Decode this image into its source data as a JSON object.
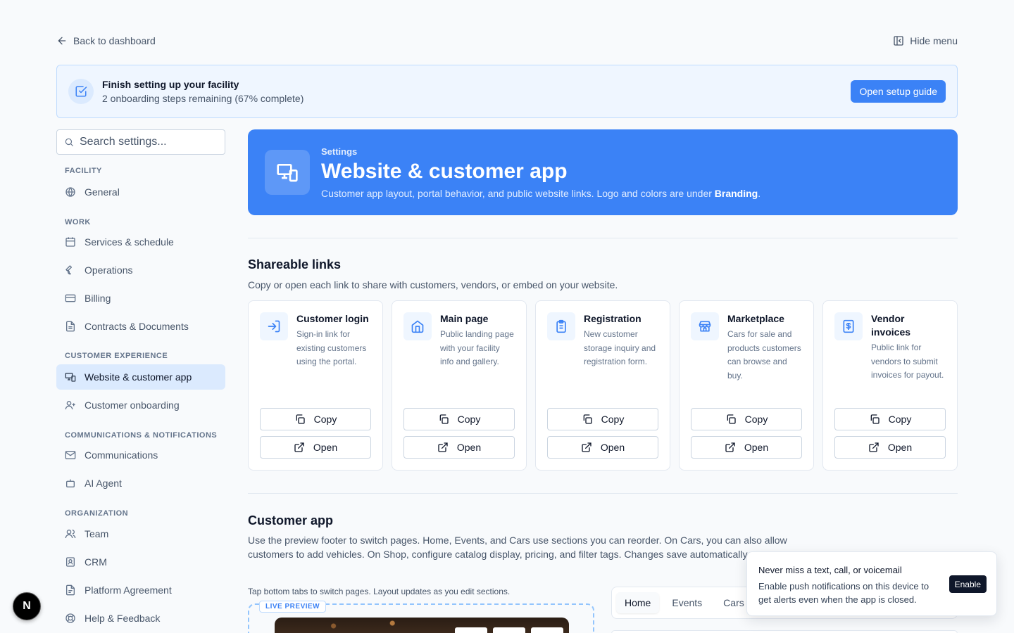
{
  "topbar": {
    "back_label": "Back to dashboard",
    "hide_menu_label": "Hide menu"
  },
  "setup": {
    "title": "Finish setting up your facility",
    "subtitle": "2 onboarding steps remaining (67% complete)",
    "button_label": "Open setup guide"
  },
  "sidebar": {
    "search_placeholder": "Search settings...",
    "groups": [
      {
        "heading": "FACILITY",
        "items": [
          {
            "label": "General",
            "icon": "globe-icon"
          }
        ]
      },
      {
        "heading": "WORK",
        "items": [
          {
            "label": "Services & schedule",
            "icon": "calendar-icon"
          },
          {
            "label": "Operations",
            "icon": "wrench-icon"
          },
          {
            "label": "Billing",
            "icon": "credit-card-icon"
          },
          {
            "label": "Contracts & Documents",
            "icon": "document-icon"
          }
        ]
      },
      {
        "heading": "CUSTOMER EXPERIENCE",
        "items": [
          {
            "label": "Website & customer app",
            "icon": "devices-icon",
            "active": true
          },
          {
            "label": "Customer onboarding",
            "icon": "user-plus-icon"
          }
        ]
      },
      {
        "heading": "COMMUNICATIONS & NOTIFICATIONS",
        "items": [
          {
            "label": "Communications",
            "icon": "mail-icon"
          },
          {
            "label": "AI Agent",
            "icon": "bot-icon"
          }
        ]
      },
      {
        "heading": "ORGANIZATION",
        "items": [
          {
            "label": "Team",
            "icon": "users-icon"
          },
          {
            "label": "CRM",
            "icon": "contact-icon"
          },
          {
            "label": "Platform Agreement",
            "icon": "file-text-icon"
          },
          {
            "label": "Help & Feedback",
            "icon": "help-icon"
          }
        ]
      }
    ]
  },
  "hero": {
    "eyebrow": "Settings",
    "title": "Website & customer app",
    "desc_prefix": "Customer app layout, portal behavior, and public website links. Logo and colors are under ",
    "desc_bold": "Branding",
    "desc_suffix": "."
  },
  "shareable": {
    "title": "Shareable links",
    "desc": "Copy or open each link to share with customers, vendors, or embed on your website.",
    "copy_label": "Copy",
    "open_label": "Open",
    "cards": [
      {
        "title": "Customer login",
        "desc": "Sign-in link for existing customers using the portal.",
        "icon": "login-icon"
      },
      {
        "title": "Main page",
        "desc": "Public landing page with your facility info and gallery.",
        "icon": "home-icon"
      },
      {
        "title": "Registration",
        "desc": "New customer storage inquiry and registration form.",
        "icon": "clipboard-icon"
      },
      {
        "title": "Marketplace",
        "desc": "Cars for sale and products customers can browse and buy.",
        "icon": "store-icon"
      },
      {
        "title": "Vendor invoices",
        "desc": "Public link for vendors to submit invoices for payout.",
        "icon": "invoice-icon"
      }
    ]
  },
  "customer_app": {
    "title": "Customer app",
    "desc": "Use the preview footer to switch pages. Home, Events, and Cars use sections you can reorder. On Cars, you can also allow customers to add vehicles. On Shop, configure catalog display, pricing, and filter tags. Changes save automatically.",
    "tip": "Tap bottom tabs to switch pages. Layout updates as you edit sections.",
    "live_preview": "LIVE PREVIEW",
    "tabs": [
      "Home",
      "Events",
      "Cars"
    ],
    "active_tab": "Home"
  },
  "toast": {
    "title": "Never miss a text, call, or voicemail",
    "body": "Enable push notifications on this device to get alerts even when the app is closed.",
    "button_label": "Enable"
  },
  "badge": {
    "letter": "N"
  },
  "colors": {
    "accent": "#3b82f6",
    "accent_light": "#eff6ff",
    "active_nav": "#dbeafe"
  }
}
